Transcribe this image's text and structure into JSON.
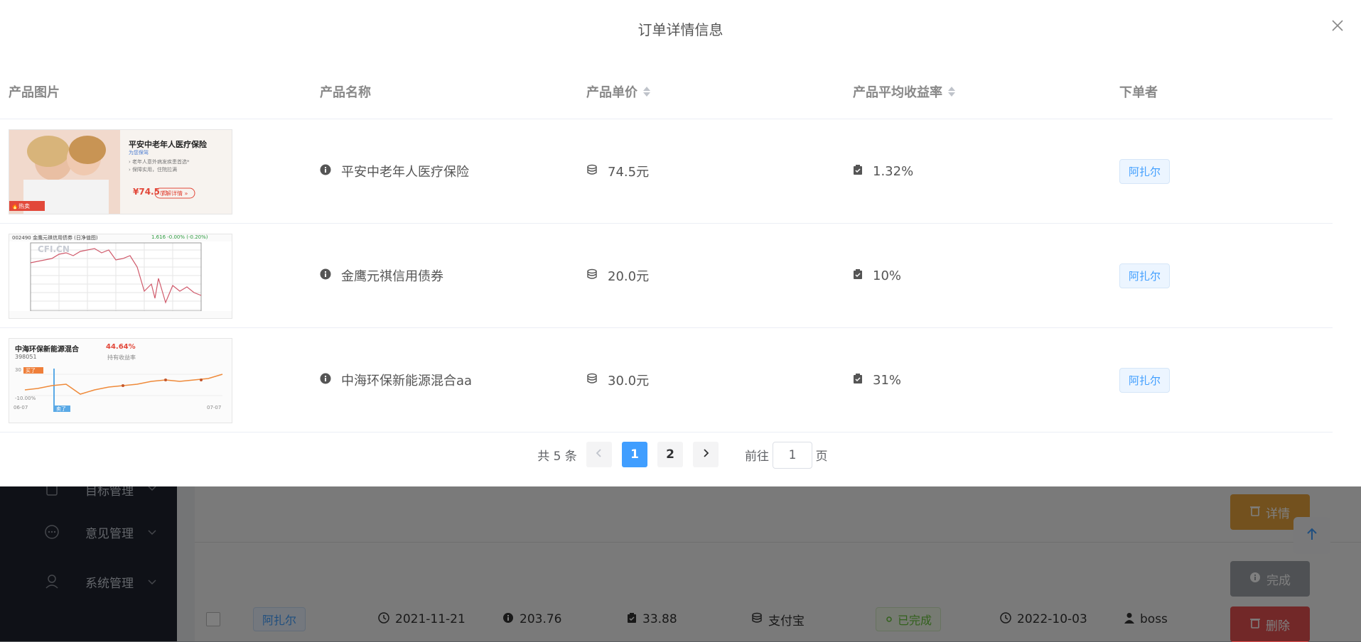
{
  "background": {
    "sidebar": {
      "items": [
        {
          "label": "目标管理",
          "icon": "square-icon"
        },
        {
          "label": "意见管理",
          "icon": "chat-bubble-icon"
        },
        {
          "label": "系统管理",
          "icon": "user-icon"
        }
      ]
    },
    "buttons": {
      "detail": "详情",
      "done": "完成",
      "delete": "删除"
    },
    "row": {
      "user_tag": "阿扎尔",
      "date": "2021-11-21",
      "amount": "203.76",
      "rate": "33.88",
      "payment": "支付宝",
      "status": "已完成",
      "finish_date": "2022-10-03",
      "operator": "boss"
    }
  },
  "dialog": {
    "title": "订单详情信息",
    "columns": {
      "image": "产品图片",
      "name": "产品名称",
      "price": "产品单价",
      "rate": "产品平均收益率",
      "buyer": "下单者"
    },
    "rows": [
      {
        "name": "平安中老年人医疗保险",
        "price": "74.5元",
        "rate": "1.32%",
        "buyer": "阿扎尔",
        "thumb": {
          "title": "平安中老年人医疗保险",
          "sub": "为您保驾",
          "line1": "› 老年人意外病发疾患首选*",
          "line2": "› 保障实用，住院拉满",
          "price": "¥74.5",
          "price_unit": "/起",
          "cta": "了解详情 »",
          "badge": "🔥热卖"
        }
      },
      {
        "name": "金鹰元祺信用债券",
        "price": "20.0元",
        "rate": "10%",
        "buyer": "阿扎尔",
        "thumb": {
          "header": "002490 金鹰元祺信用债券  (日净值图)",
          "header_right": "1.616 -0.00% (-0.20%)",
          "watermark": "CFI.CN"
        }
      },
      {
        "name": "中海环保新能源混合aa",
        "price": "30.0元",
        "rate": "31%",
        "buyer": "阿扎尔",
        "thumb": {
          "title": "中海环保新能源混合",
          "pct": "44.64%",
          "code": "398051",
          "sub": "持有收益率",
          "left_top": "30",
          "buy": "买了",
          "left_bottom": "-10.00%",
          "date_left": "06-07",
          "date_right": "07-07",
          "sell": "卖了"
        }
      }
    ],
    "pagination": {
      "total": "共 5 条",
      "pages": [
        "1",
        "2"
      ],
      "current": "1",
      "goto_label": "前往",
      "goto_value": "1",
      "page_suffix": "页"
    }
  },
  "colors": {
    "primary": "#409eff",
    "warning": "#e6a23c",
    "danger": "#e45151",
    "success": "#67c23a",
    "sidebar": "#1f232e"
  }
}
